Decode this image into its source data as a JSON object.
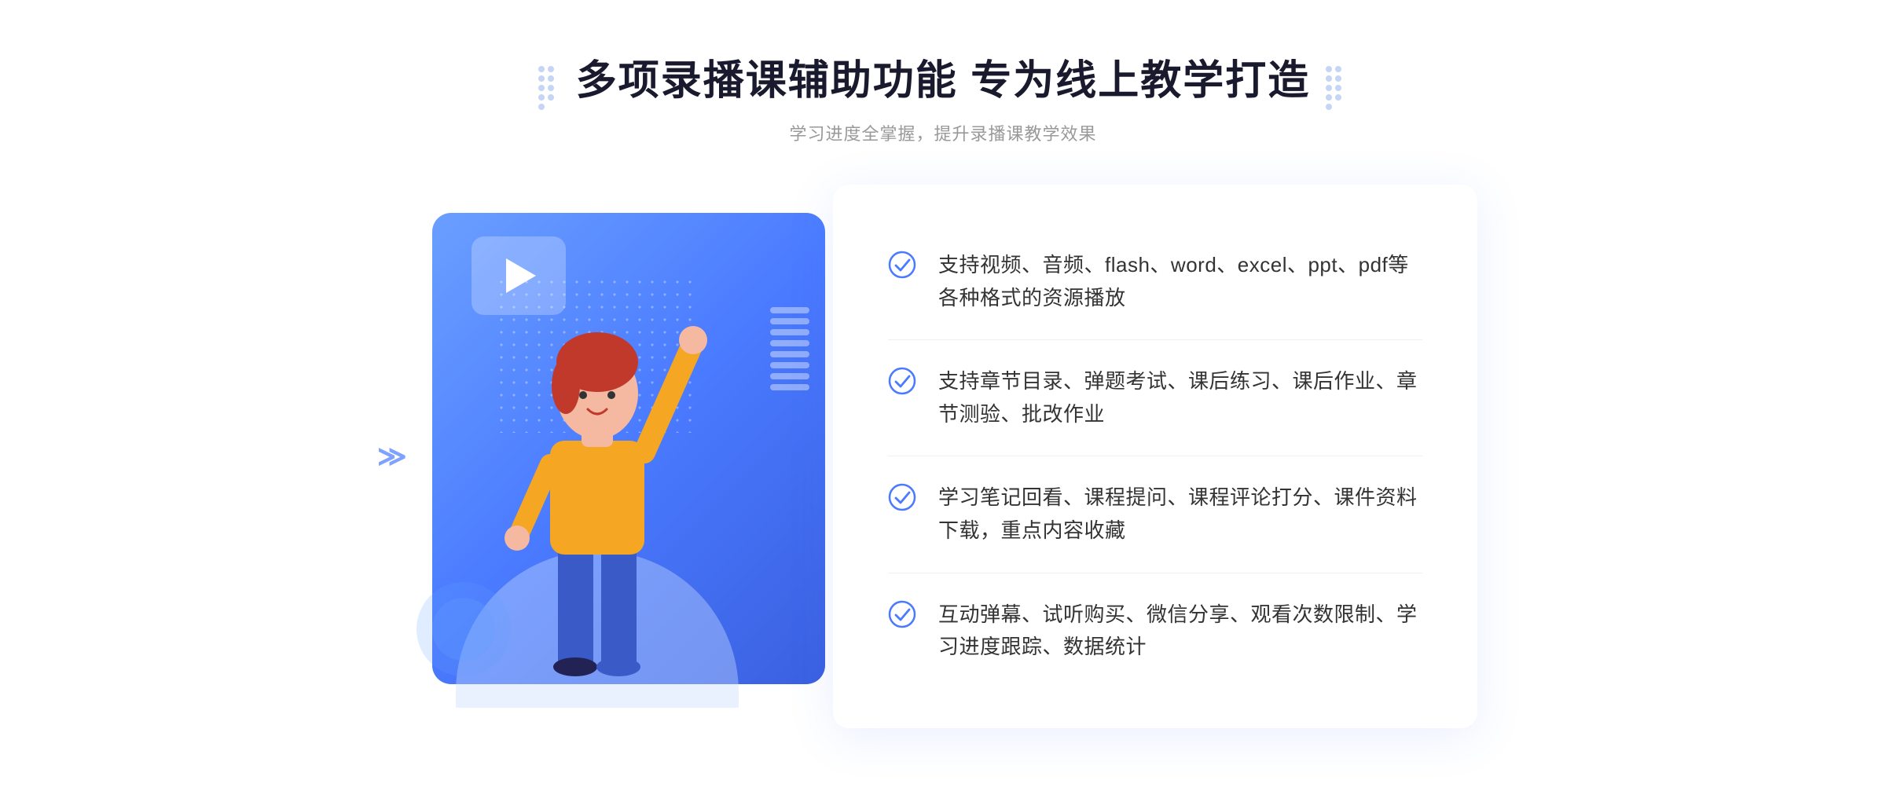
{
  "header": {
    "title": "多项录播课辅助功能 专为线上教学打造",
    "subtitle": "学习进度全掌握，提升录播课教学效果",
    "dots_left": "decorative-dots",
    "dots_right": "decorative-dots"
  },
  "features": [
    {
      "id": 1,
      "text": "支持视频、音频、flash、word、excel、ppt、pdf等各种格式的资源播放"
    },
    {
      "id": 2,
      "text": "支持章节目录、弹题考试、课后练习、课后作业、章节测验、批改作业"
    },
    {
      "id": 3,
      "text": "学习笔记回看、课程提问、课程评论打分、课件资料下载，重点内容收藏"
    },
    {
      "id": 4,
      "text": "互动弹幕、试听购买、微信分享、观看次数限制、学习进度跟踪、数据统计"
    }
  ],
  "colors": {
    "primary": "#4a7aff",
    "primary_light": "#6a9fff",
    "check_color": "#4a7aff",
    "title_color": "#1a1a2e",
    "text_color": "#333333",
    "subtitle_color": "#999999"
  },
  "icons": {
    "check": "check-circle-icon",
    "play": "play-icon",
    "dots": "dots-decoration-icon",
    "chevrons": "chevrons-icon"
  }
}
